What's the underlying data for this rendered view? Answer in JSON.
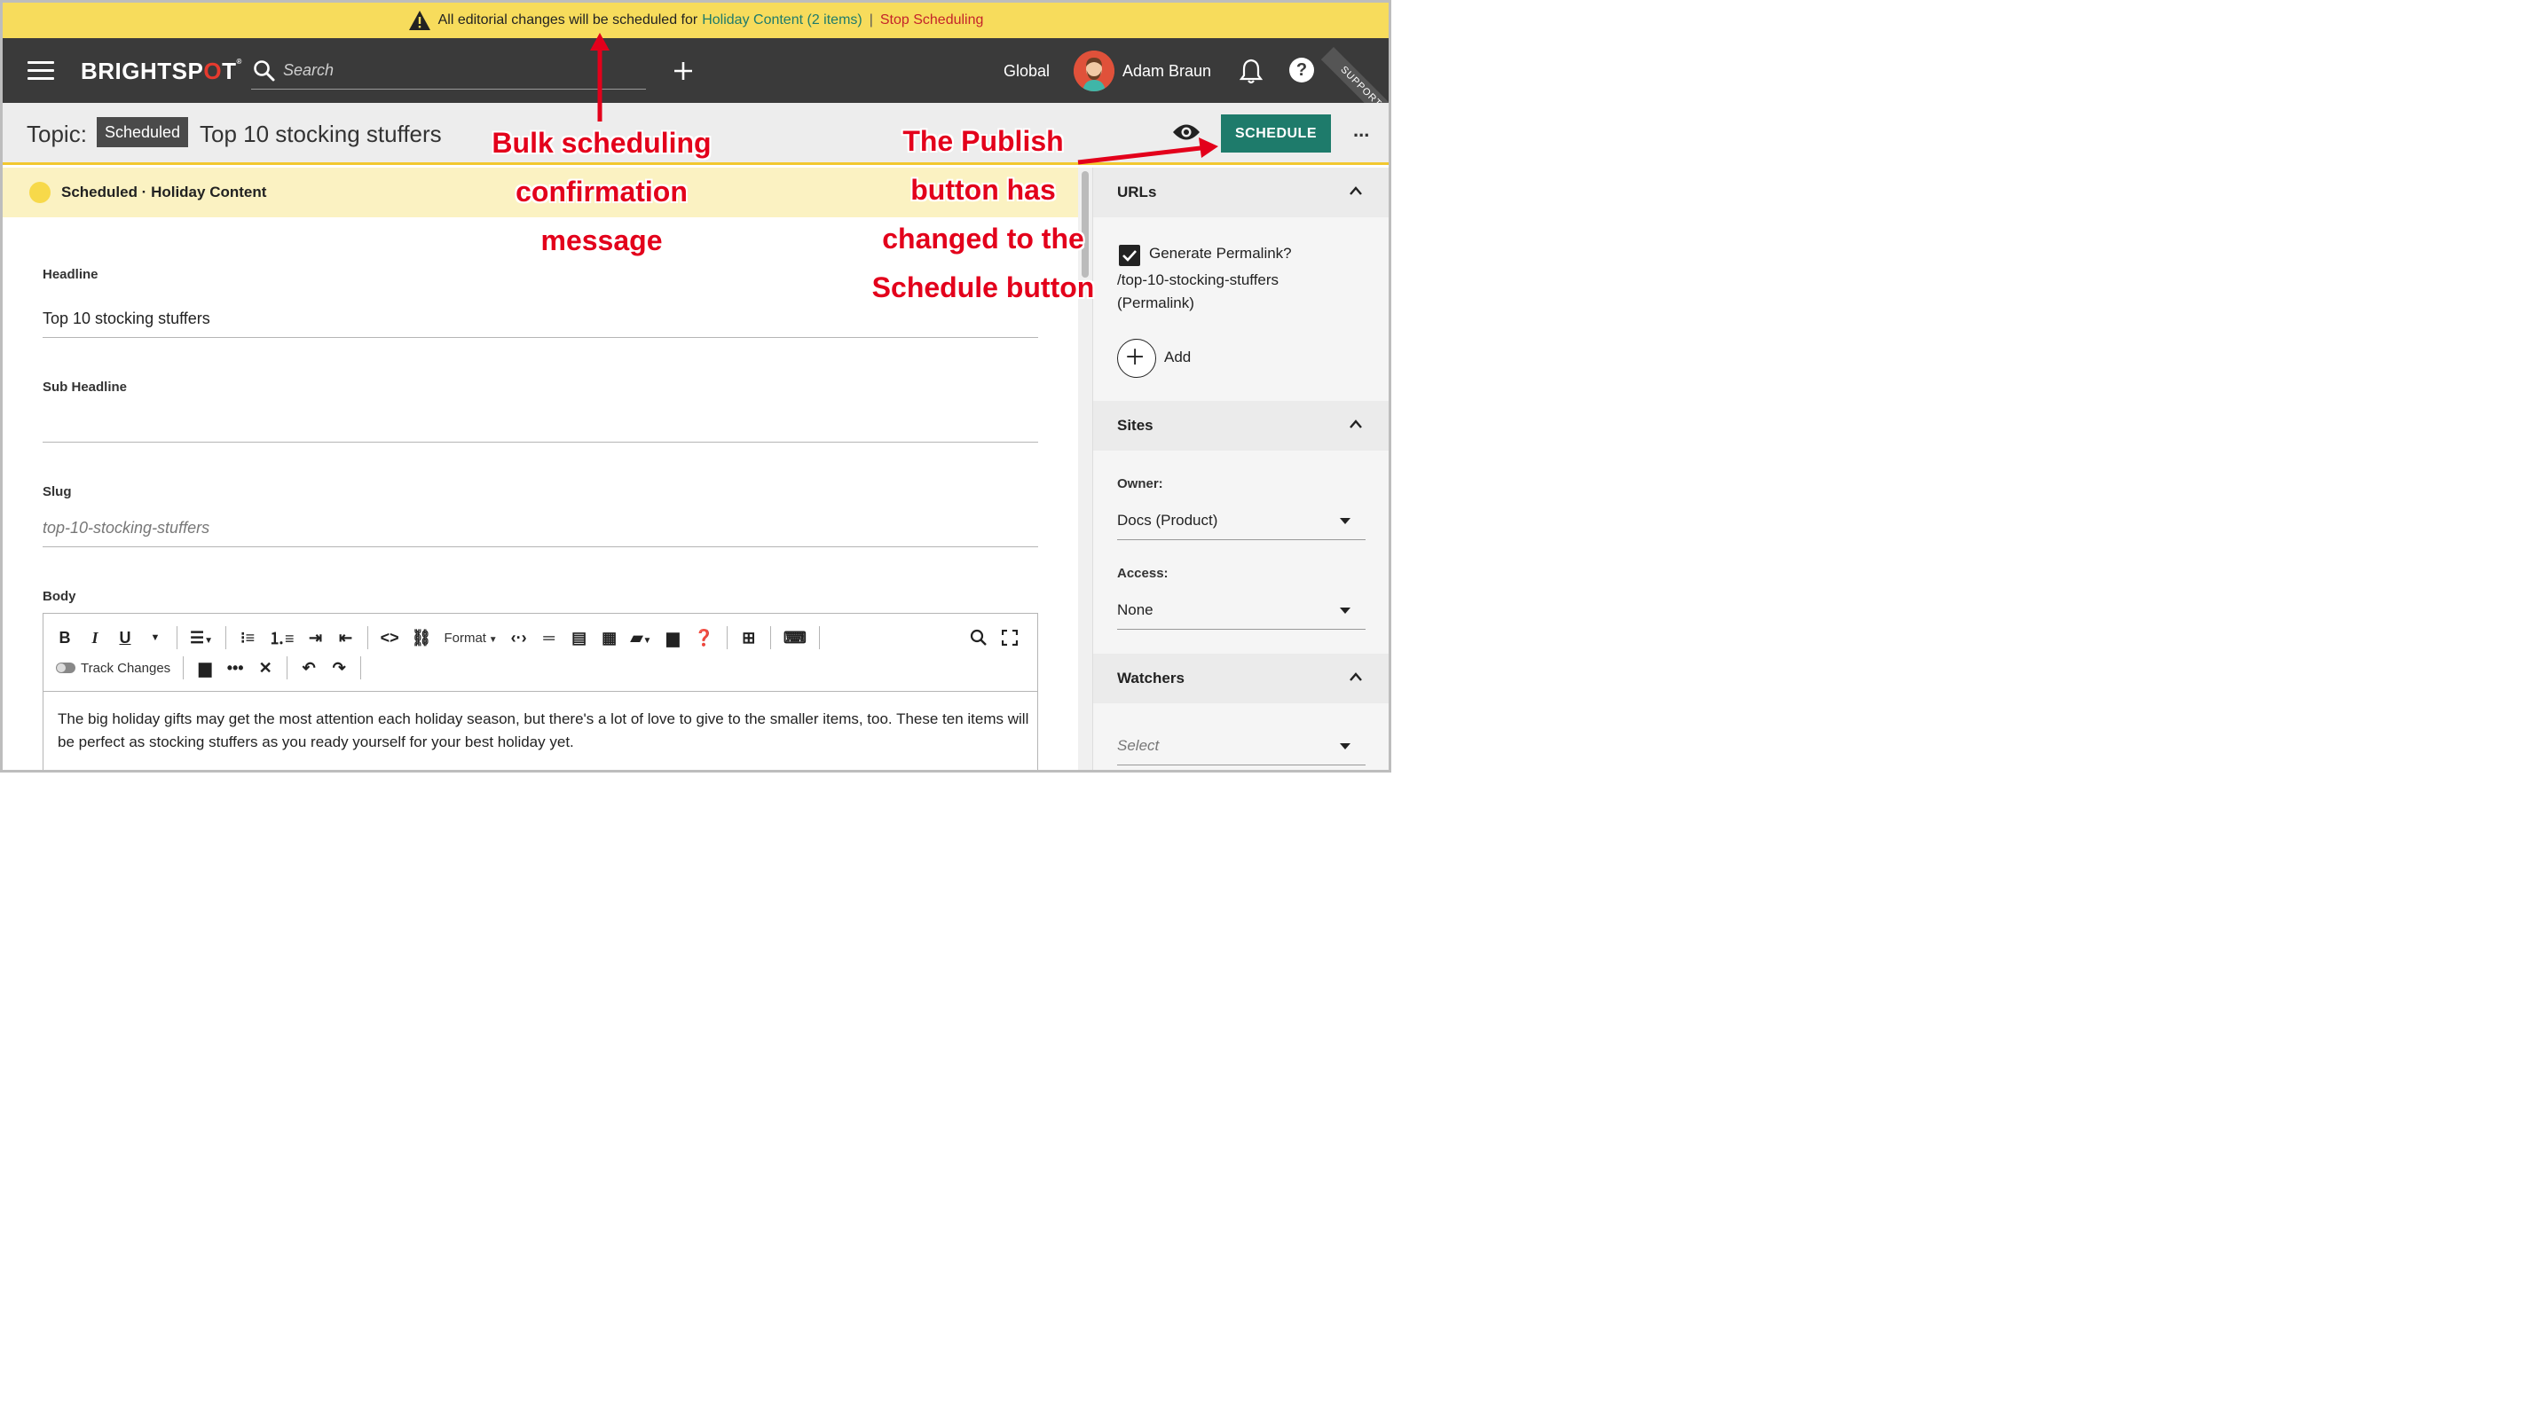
{
  "banner": {
    "message": "All editorial changes will be scheduled for",
    "schedule_link": "Holiday Content (2 items)",
    "separator": "|",
    "stop_link": "Stop Scheduling"
  },
  "topbar": {
    "logo_pre": "BRIGHTSP",
    "logo_o": "O",
    "logo_post": "T",
    "logo_mark": "®",
    "search_placeholder": "Search",
    "site": "Global",
    "user_name": "Adam Braun",
    "help_symbol": "?",
    "ribbon": "SUPPORT C"
  },
  "titlebar": {
    "prefix": "Topic:",
    "status": "Scheduled",
    "title": "Top 10 stocking stuffers",
    "schedule_label": "SCHEDULE",
    "more_label": "..."
  },
  "status_strip": {
    "text": "Scheduled · Holiday Content"
  },
  "form": {
    "headline_label": "Headline",
    "headline_value": "Top 10 stocking stuffers",
    "subheadline_label": "Sub Headline",
    "slug_label": "Slug",
    "slug_value": "top-10-stocking-stuffers",
    "body_label": "Body",
    "body_text": "The big holiday gifts may get the most attention each holiday season, but there's a lot of love to give to the smaller items, too. These ten items will be perfect as stocking stuffers as you ready yourself for your best holiday yet."
  },
  "toolbar": {
    "bold": "B",
    "italic": "I",
    "underline": "U",
    "format_label": "Format",
    "track_changes": "Track Changes"
  },
  "sidebar": {
    "urls_title": "URLs",
    "generate_permalink": "Generate Permalink?",
    "permalink_path": "/top-10-stocking-stuffers",
    "permalink_type": "(Permalink)",
    "add_label": "Add",
    "sites_title": "Sites",
    "owner_label": "Owner:",
    "owner_value": "Docs (Product)",
    "access_label": "Access:",
    "access_value": "None",
    "watchers_title": "Watchers",
    "watchers_placeholder": "Select"
  },
  "annotations": {
    "bulk_line1": "Bulk scheduling",
    "bulk_line2": "confirmation",
    "bulk_line3": "message",
    "publish_line1": "The Publish",
    "publish_line2": "button has",
    "publish_line3": "changed to the",
    "publish_line4": "Schedule button"
  },
  "colors": {
    "banner_bg": "#f7dc5c",
    "topbar_bg": "#3a3a3a",
    "schedule_button": "#1e7b6b",
    "annotation": "#e3001b",
    "status_strip_bg": "#fbf2c2"
  }
}
